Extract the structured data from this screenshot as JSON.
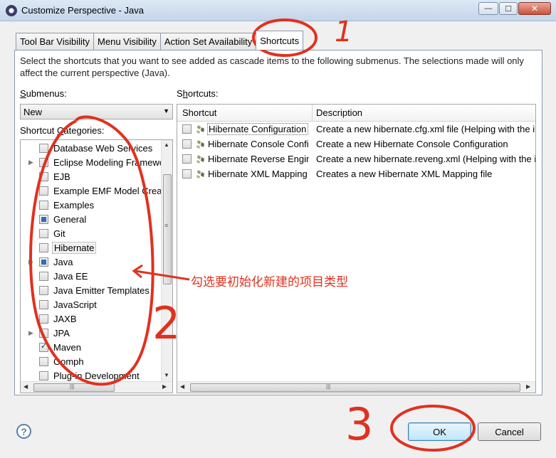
{
  "window": {
    "title": "Customize Perspective - Java",
    "minimize_glyph": "—",
    "maximize_glyph": "☐",
    "close_glyph": "✕"
  },
  "tabs": [
    {
      "label": "Tool Bar Visibility",
      "active": false
    },
    {
      "label": "Menu Visibility",
      "active": false
    },
    {
      "label": "Action Set Availability",
      "active": false
    },
    {
      "label": "Shortcuts",
      "active": true
    }
  ],
  "description": "Select the shortcuts that you want to see added as cascade items to the following submenus.  The selections made will only affect the current perspective (Java).",
  "submenus": {
    "label_underlined": "S",
    "label_rest": "ubmenus:",
    "selected": "New",
    "arrow": "▼"
  },
  "categories": {
    "label_pre": "Shortcut ",
    "label_underlined": "C",
    "label_rest": "ategories:",
    "items": [
      {
        "label": "Database Web Services",
        "state": "empty",
        "expandable": false
      },
      {
        "label": "Eclipse Modeling Framework",
        "state": "empty",
        "expandable": true
      },
      {
        "label": "EJB",
        "state": "empty",
        "expandable": false
      },
      {
        "label": "Example EMF Model Creation Wizards",
        "state": "empty",
        "expandable": false
      },
      {
        "label": "Examples",
        "state": "empty",
        "expandable": false
      },
      {
        "label": "General",
        "state": "filled",
        "expandable": false
      },
      {
        "label": "Git",
        "state": "empty",
        "expandable": false
      },
      {
        "label": "Hibernate",
        "state": "empty",
        "expandable": false,
        "selected": true
      },
      {
        "label": "Java",
        "state": "filled",
        "expandable": true
      },
      {
        "label": "Java EE",
        "state": "empty",
        "expandable": false
      },
      {
        "label": "Java Emitter Templates",
        "state": "empty",
        "expandable": false
      },
      {
        "label": "JavaScript",
        "state": "empty",
        "expandable": false
      },
      {
        "label": "JAXB",
        "state": "empty",
        "expandable": false
      },
      {
        "label": "JPA",
        "state": "empty",
        "expandable": true
      },
      {
        "label": "Maven",
        "state": "checked",
        "expandable": false
      },
      {
        "label": "Oomph",
        "state": "empty",
        "expandable": false
      },
      {
        "label": "Plug-in Development",
        "state": "empty",
        "expandable": false
      }
    ]
  },
  "shortcuts": {
    "label_underlined": "h",
    "label_pre": "S",
    "label_rest": "ortcuts:",
    "columns": [
      "Shortcut",
      "Description"
    ],
    "rows": [
      {
        "name": "Hibernate Configuration File (cfg.xml)",
        "description": "Create a new hibernate.cfg.xml file (Helping with the initial configuration)"
      },
      {
        "name": "Hibernate Console Configuration",
        "description": "Create a new Hibernate Console Configuration"
      },
      {
        "name": "Hibernate Reverse Engineering File (reveng.xml)",
        "description": "Create a new hibernate.reveng.xml (Helping with the initial configuration)"
      },
      {
        "name": "Hibernate XML Mapping file (hbm.xml)",
        "description": "Creates a new Hibernate XML Mapping file"
      }
    ]
  },
  "annotations": {
    "step1": "1",
    "step2": "2",
    "step3": "3",
    "note": "勾选要初始化新建的项目类型",
    "color": "#e0311f"
  },
  "buttons": {
    "help": "?",
    "ok": "OK",
    "cancel": "Cancel"
  },
  "scroll_glyphs": {
    "up": "▲",
    "down": "▼",
    "left": "◀",
    "right": "▶",
    "grip_v": "≡",
    "grip_h": "|||"
  }
}
